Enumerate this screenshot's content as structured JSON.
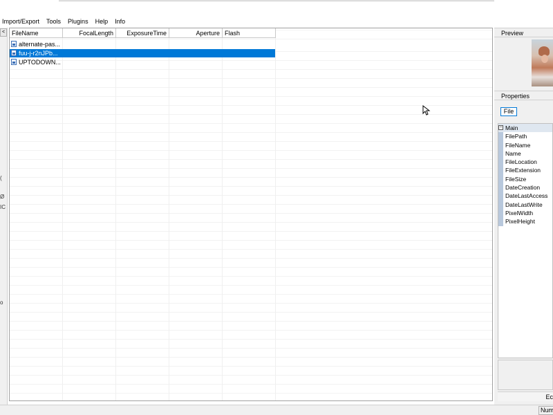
{
  "menu": [
    "Import/Export",
    "Tools",
    "Plugins",
    "Help",
    "Info"
  ],
  "left_strip": {
    "top_button": "<",
    "chars": [
      "(",
      "Ø",
      "IC",
      "o"
    ]
  },
  "listview": {
    "columns": [
      "FileName",
      "FocalLength",
      "ExposureTime",
      "Aperture",
      "Flash"
    ],
    "rows": [
      {
        "name": "alternate-pas...",
        "selected": false
      },
      {
        "name": "fuu-j-r2nJPb...",
        "selected": true
      },
      {
        "name": "UPTODOWN...",
        "selected": false
      }
    ]
  },
  "right_panel": {
    "preview_label": "Preview",
    "properties_label": "Properties",
    "file_tab": "File",
    "category": "Main",
    "category_toggle": "−",
    "properties": [
      "FilePath",
      "FileName",
      "Name",
      "FileLocation",
      "FileExtension",
      "FileSize",
      "DateCreation",
      "DateLastAccess",
      "DateLastWrite",
      "PixelWidth",
      "PixelHeight"
    ],
    "edit_label": "Ec"
  },
  "status": {
    "num_label": "Num"
  },
  "colors": {
    "selection": "#0078d7",
    "grid_gutter": "#b8c8dc"
  }
}
